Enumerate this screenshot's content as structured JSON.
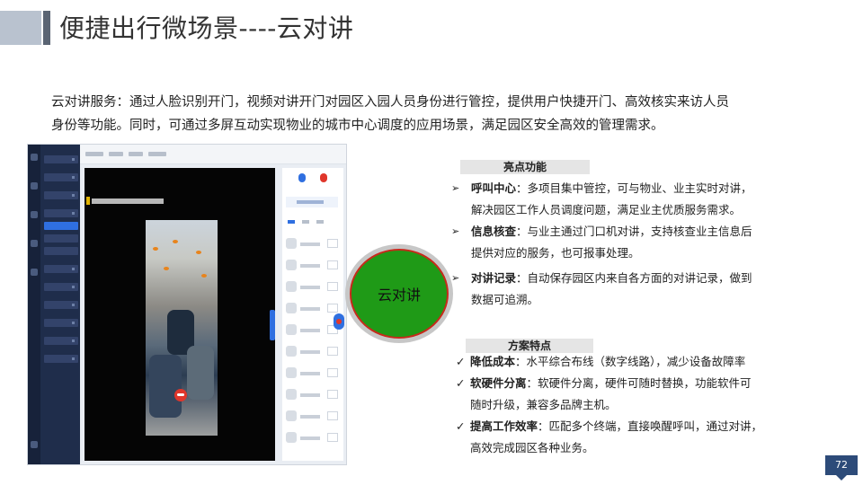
{
  "title": "便捷出行微场景----云对讲",
  "intro": {
    "line1": "云对讲服务：通过人脸识别开门，视频对讲开门对园区入园人员身份进行管控，提供用户快捷开门、高效核实来访人员",
    "line2": "身份等功能。同时，可通过多屏互动实现物业的城市中心调度的应用场景，满足园区安全高效的管理需求。"
  },
  "center_label": "云对讲",
  "highlights": {
    "heading": "亮点功能",
    "items": [
      {
        "name": "呼叫中心",
        "sep": "：",
        "line1": "多项目集中管控，可与物业、业主实时对讲，",
        "line2": "解决园区工作人员调度问题，满足业主优质服务需求。"
      },
      {
        "name": "信息核查",
        "sep": "：",
        "line1": "与业主通过门口机对讲，支持核查业主信息后",
        "line2": "提供对应的服务，也可报事处理。"
      },
      {
        "name": "对讲记录",
        "sep": "：",
        "line1": "自动保存园区内来自各方面的对讲记录，做到",
        "line2": "数据可追溯。"
      }
    ]
  },
  "features": {
    "heading": "方案特点",
    "items": [
      {
        "name": "降低成本",
        "sep": "：",
        "line1": "水平综合布线（数字线路），减少设备故障率",
        "line2": ""
      },
      {
        "name": "软硬件分离",
        "sep": "：",
        "line1": "软硬件分离，硬件可随时替换，功能软件可",
        "line2": "随时升级，兼容多品牌主机。"
      },
      {
        "name": "提高工作效率",
        "sep": "：",
        "line1": "匹配多个终端，直接唤醒呼叫，通过对讲，",
        "line2": "高效完成园区各种业务。"
      }
    ]
  },
  "page_number": "72",
  "icons": {
    "bullet_arrow": "➢",
    "check_mark": "✓"
  },
  "colors": {
    "accent_green": "#1f9a17",
    "ring_red": "#c72a1b",
    "page_badge": "#2d4b79"
  }
}
